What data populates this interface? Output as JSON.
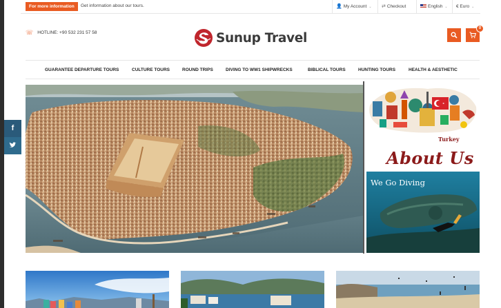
{
  "topbar": {
    "info_label": "For more information",
    "info_text": "Get information about our tours.",
    "account": "My Account",
    "checkout": "Checkout",
    "language": "English",
    "currency": "€ Euro"
  },
  "header": {
    "hotline": "HOTLINE: +90 532 231 57 58",
    "logo_text": "Sunup Travel",
    "cart_count": "0"
  },
  "nav": {
    "items": [
      "GUARANTEE DEPARTURE TOURS",
      "CULTURE TOURS",
      "ROUND TRIPS",
      "DIVING TO WW1 SHIPWRECKS",
      "BIBLICAL TOURS",
      "HUNTING TOURS",
      "HEALTH & AESTHETIC"
    ]
  },
  "side": {
    "turkey_label": "Turkey",
    "about_label": "About Us",
    "diving_title": "We Go Diving"
  },
  "social": {
    "facebook": "f",
    "twitter": "t"
  },
  "colors": {
    "accent": "#e95b22",
    "brand_red": "#c0262d",
    "dark": "#3a3a3a"
  }
}
